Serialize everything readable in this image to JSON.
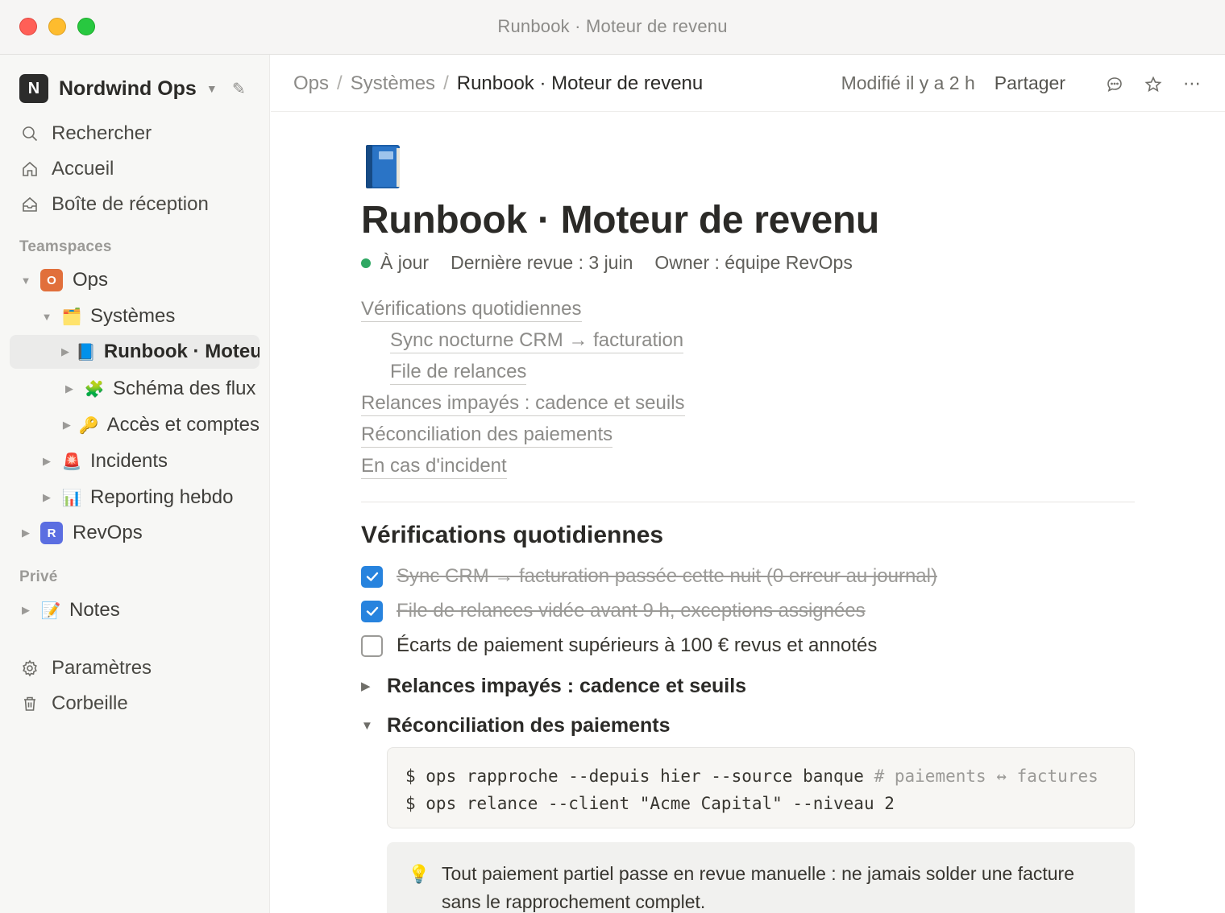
{
  "window": {
    "title": "Runbook · Moteur de revenu"
  },
  "sidebar": {
    "workspace": {
      "logo": "N",
      "name": "Nordwind Ops"
    },
    "nav": [
      {
        "label": "Rechercher",
        "icon": "search-icon"
      },
      {
        "label": "Accueil",
        "icon": "home-icon"
      },
      {
        "label": "Boîte de réception",
        "icon": "inbox-icon"
      }
    ],
    "teamspaces_label": "Teamspaces",
    "tree": [
      {
        "label": "Ops",
        "badge": "O",
        "badge_color": "#e16f3b",
        "expanded": true
      },
      {
        "label": "Systèmes",
        "emoji": "🗂️",
        "expanded": true
      },
      {
        "label": "Runbook · Moteur de revenu",
        "emoji": "📘",
        "selected": true
      },
      {
        "label": "Schéma des flux",
        "emoji": "🧩"
      },
      {
        "label": "Accès et comptes",
        "emoji": "🔑"
      },
      {
        "label": "Incidents",
        "emoji": "🚨"
      },
      {
        "label": "Reporting hebdo",
        "emoji": "📊"
      },
      {
        "label": "RevOps",
        "badge": "R",
        "badge_color": "#5b6ee1"
      }
    ],
    "private_label": "Privé",
    "private_items": [
      {
        "label": "Notes",
        "emoji": "📝"
      }
    ],
    "footer": [
      {
        "label": "Paramètres",
        "icon": "gear-icon"
      },
      {
        "label": "Corbeille",
        "icon": "trash-icon"
      }
    ]
  },
  "topbar": {
    "breadcrumbs": [
      "Ops",
      "Systèmes",
      "Runbook · Moteur de revenu"
    ],
    "separator": "/",
    "edited": "Modifié il y a 2 h",
    "share": "Partager"
  },
  "page": {
    "icon": "book-icon",
    "title": "Runbook · Moteur de revenu",
    "status": "À jour",
    "status_color": "#2fa863",
    "last_review": "Dernière revue : 3 juin",
    "owner": "Owner : équipe RevOps",
    "toc": [
      {
        "label": "Vérifications quotidiennes",
        "level": 1
      },
      {
        "label": "Sync nocturne CRM → facturation",
        "level": 2
      },
      {
        "label": "File de relances",
        "level": 2
      },
      {
        "label": "Relances impayés : cadence et seuils",
        "level": 1
      },
      {
        "label": "Réconciliation des paiements",
        "level": 1
      },
      {
        "label": "En cas d'incident",
        "level": 1
      }
    ],
    "section_heading": "Vérifications quotidiennes",
    "todos": [
      {
        "text": "Sync CRM → facturation passée cette nuit (0 erreur au journal)",
        "checked": true
      },
      {
        "text": "File de relances vidée avant 9 h, exceptions assignées",
        "checked": true
      },
      {
        "text": "Écarts de paiement supérieurs à 100 € revus et annotés",
        "checked": false
      }
    ],
    "toggles": [
      {
        "label": "Relances impayés : cadence et seuils",
        "expanded": false
      },
      {
        "label": "Réconciliation des paiements",
        "expanded": true
      }
    ],
    "code": {
      "line1": "$ ops rapproche --depuis hier --source banque",
      "line1_comment": " # paiements ↔ factures",
      "line2": "$ ops relance --client \"Acme Capital\" --niveau 2"
    },
    "callout": {
      "icon": "💡",
      "text": "Tout paiement partiel passe en revue manuelle : ne jamais solder une facture sans le rapprochement complet."
    }
  }
}
